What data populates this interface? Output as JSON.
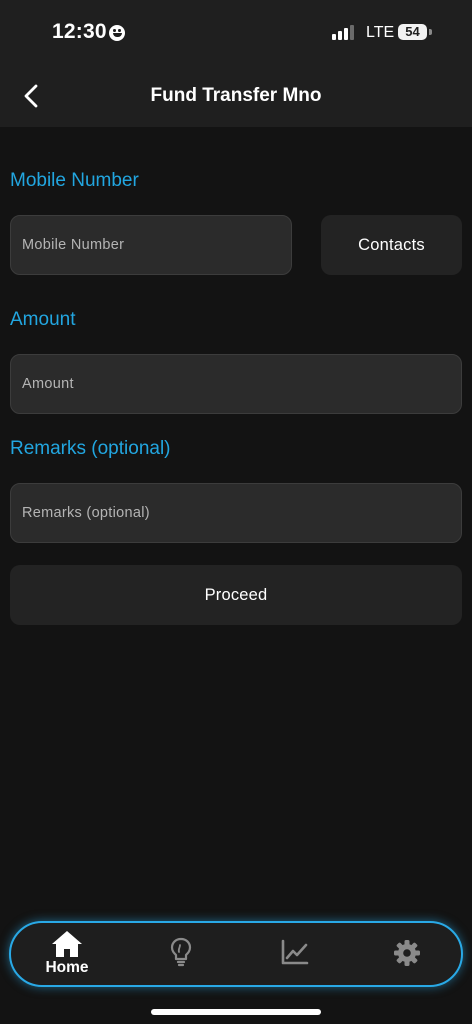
{
  "status_bar": {
    "time": "12:30",
    "network": "LTE",
    "battery": "54"
  },
  "header": {
    "title": "Fund Transfer Mno",
    "back_icon": "chevron-left-icon"
  },
  "form": {
    "mobile_label": "Mobile Number",
    "mobile_placeholder": "Mobile Number",
    "contacts_label": "Contacts",
    "amount_label": "Amount",
    "amount_placeholder": "Amount",
    "remarks_label": "Remarks (optional)",
    "remarks_placeholder": "Remarks (optional)",
    "proceed_label": "Proceed"
  },
  "bottom_nav": {
    "items": [
      {
        "icon": "home-icon",
        "label": "Home",
        "active": true
      },
      {
        "icon": "lightbulb-icon",
        "label": "",
        "active": false
      },
      {
        "icon": "chart-line-icon",
        "label": "",
        "active": false
      },
      {
        "icon": "gear-icon",
        "label": "",
        "active": false
      }
    ]
  },
  "colors": {
    "accent": "#22a6e0",
    "background": "#131313",
    "header": "#1f1f1f",
    "input": "#2b2b2b",
    "inactive_icon": "#8a8a8a"
  }
}
